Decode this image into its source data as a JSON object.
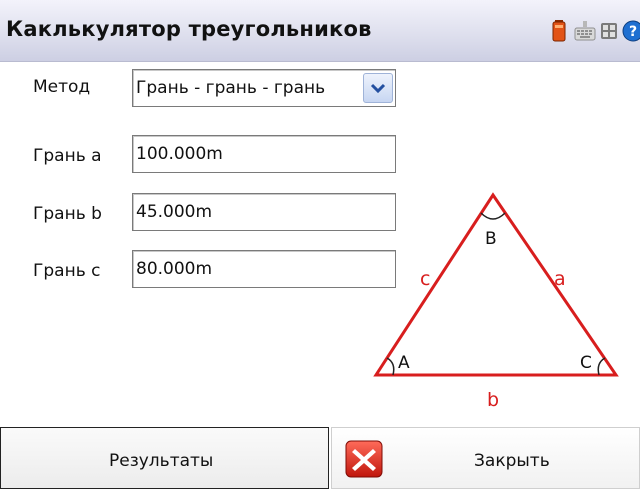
{
  "window": {
    "title": "Каклькулятор треугольников"
  },
  "form": {
    "method_label": "Метод",
    "method_value": "Грань - грань - грань",
    "side_a_label": "Грань a",
    "side_a_value": "100.000m",
    "side_b_label": "Грань b",
    "side_b_value": "45.000m",
    "side_c_label": "Грань c",
    "side_c_value": "80.000m"
  },
  "diagram": {
    "vertex_a": "A",
    "vertex_b": "B",
    "vertex_c": "C",
    "side_a": "a",
    "side_b": "b",
    "side_c": "c",
    "color": "#d81e1e"
  },
  "buttons": {
    "results_label": "Результаты",
    "close_label": "Закрыть"
  },
  "icons": {
    "battery": "battery-icon",
    "keyboard": "keyboard-icon",
    "grid": "grid-icon",
    "help": "help-icon",
    "close": "close-x-icon"
  }
}
